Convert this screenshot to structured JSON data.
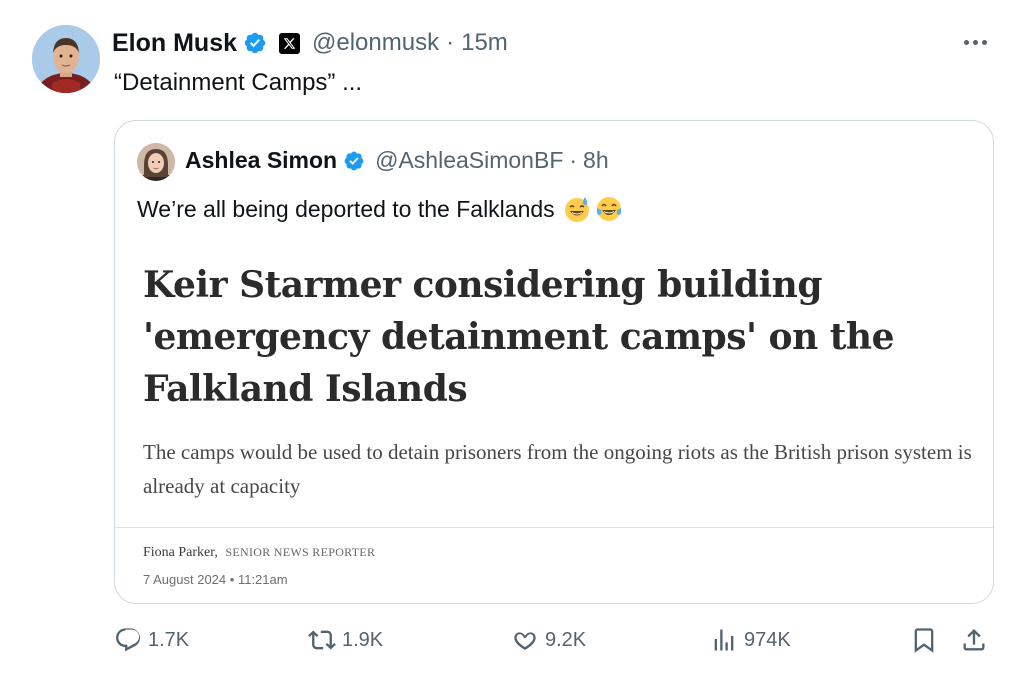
{
  "tweet": {
    "author_name": "Elon Musk",
    "author_handle": "@elonmusk",
    "separator": "·",
    "time": "15m",
    "text": "“Detainment Camps” ...",
    "icons": [
      "verified-badge-icon",
      "x-logo-icon",
      "more-options-icon"
    ]
  },
  "quote": {
    "author_name": "Ashlea Simon",
    "author_handle": "@AshleaSimonBF",
    "separator": "·",
    "time": "8h",
    "text": "We’re all being deported to the Falklands",
    "emojis": [
      "sweat-smile-emoji",
      "tears-of-joy-emoji"
    ],
    "article": {
      "headline": "Keir Starmer considering building 'emergency detainment camps' on the Falkland Islands",
      "subheading": "The camps would be used to detain prisoners from the ongoing riots as the British prison system is already at capacity",
      "author": "Fiona Parker,",
      "author_role": "SENIOR NEWS REPORTER",
      "date": "7 August 2024",
      "date_separator": "•",
      "time": "11:21am"
    }
  },
  "actions": {
    "reply_count": "1.7K",
    "repost_count": "1.9K",
    "like_count": "9.2K",
    "view_count": "974K"
  },
  "colors": {
    "verified_blue": "#1d9bf0",
    "secondary_text": "#536471",
    "border": "#cfd9de"
  }
}
